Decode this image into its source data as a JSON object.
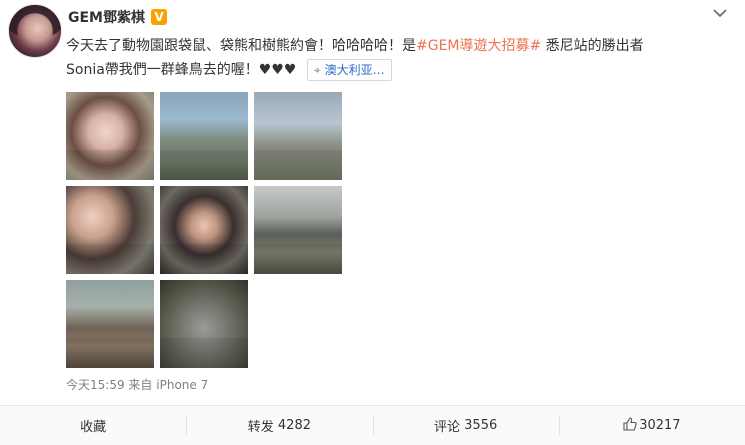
{
  "post": {
    "username": "GEM鄧紫棋",
    "verified_badge": "V",
    "text_part1": "今天去了動物園跟袋鼠、袋熊和樹熊約會！哈哈哈哈！是",
    "hashtag": "#GEM導遊大招募#",
    "text_part2": " 悉尼站的勝出者",
    "text_line2": "Sonia帶我們一群蜂鳥去的喔！♥♥♥",
    "location": "澳大利亚…",
    "time": "今天15:59",
    "source_prefix": "来自",
    "source_device": "iPhone 7",
    "menu_icon": "chevron-down-icon"
  },
  "actions": {
    "favorite": "收藏",
    "repost_label": "转发",
    "repost_count": "4282",
    "comment_label": "评论",
    "comment_count": "3556",
    "like_count": "30217"
  },
  "colors": {
    "hashtag": "#eb7350",
    "location_link": "#2a6cc8",
    "badge": "#f7a200"
  }
}
